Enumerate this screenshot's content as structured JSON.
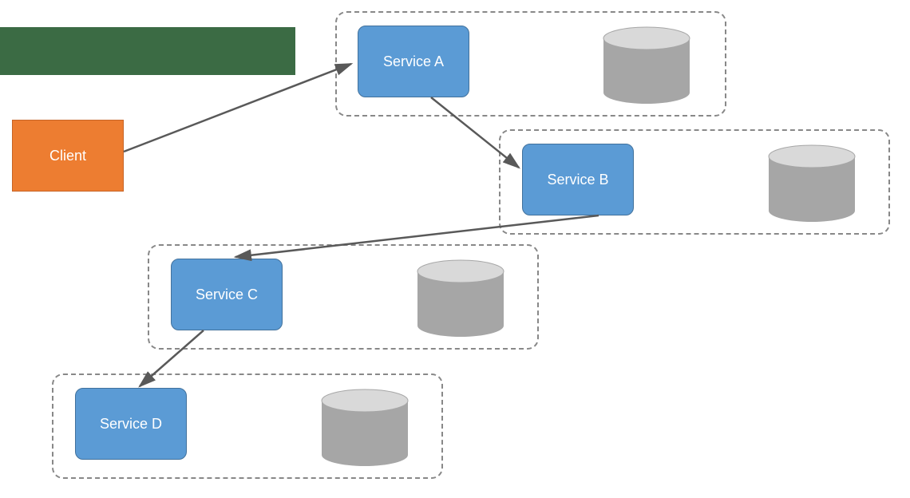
{
  "title_bar": {
    "color": "#3b6b44"
  },
  "client": {
    "label": "Client"
  },
  "services": {
    "a": {
      "label": "Service A",
      "db_label": "DB"
    },
    "b": {
      "label": "Service B",
      "db_label": "DB"
    },
    "c": {
      "label": "Service C",
      "db_label": "DB"
    },
    "d": {
      "label": "Service D",
      "db_label": "DB"
    }
  },
  "colors": {
    "client": "#ed7d31",
    "service": "#5b9bd5",
    "group_border": "#888888",
    "db_fill": "#a6a6a6",
    "db_top": "#d9d9d9",
    "arrow": "#595959",
    "title_bar": "#3b6b44"
  }
}
